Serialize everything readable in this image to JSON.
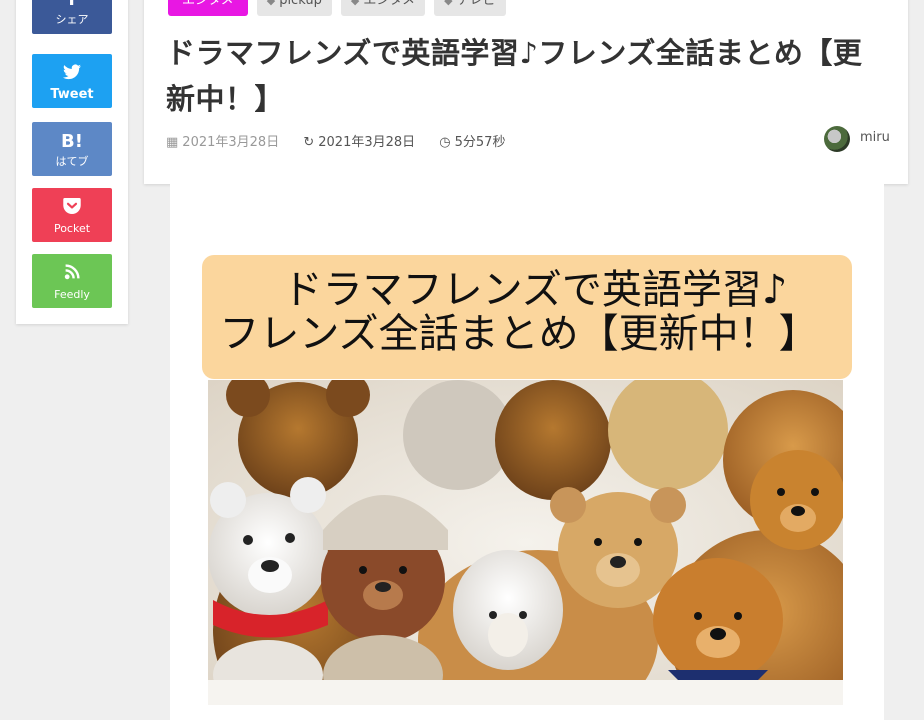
{
  "share": {
    "facebook": {
      "icon": "f",
      "label": "シェア"
    },
    "twitter": {
      "icon": "🐦",
      "label": "Tweet"
    },
    "hatena": {
      "icon": "B!",
      "label": "はてブ"
    },
    "pocket": {
      "icon": "⌄",
      "label": "Pocket"
    },
    "feedly": {
      "icon": "≫",
      "label": "Feedly"
    }
  },
  "article": {
    "category": "エンタメ",
    "tags": [
      "pickup",
      "エンタメ",
      "テレビ"
    ],
    "title": "ドラマフレンズで英語学習♪フレンズ全話まとめ【更新中！】",
    "published": "2021年3月28日",
    "updated": "2021年3月28日",
    "read_time": "5分57秒",
    "author": "miru"
  },
  "featured_image": {
    "line1": "ドラマフレンズで英語学習♪",
    "line2": "フレンズ全話まとめ【更新中！】"
  },
  "colors": {
    "category": "#e817e3",
    "facebook": "#3b5998",
    "twitter": "#1da1f2",
    "hatena": "#5d88c6",
    "pocket": "#ef4056",
    "feedly": "#6cc655",
    "banner": "#fbd69d"
  }
}
